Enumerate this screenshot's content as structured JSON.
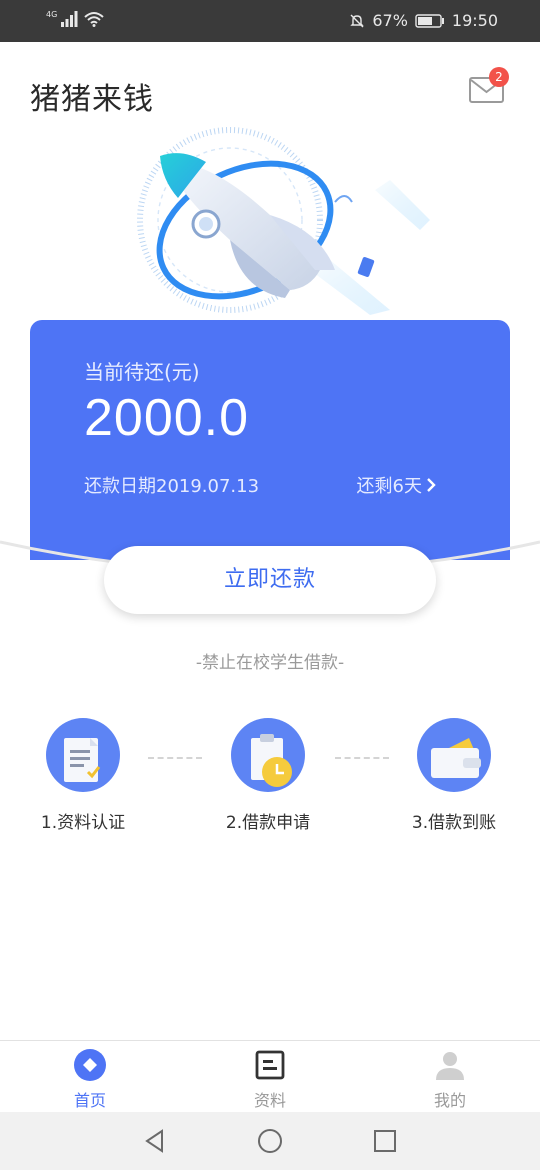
{
  "status_bar": {
    "network": "4G",
    "battery": "67%",
    "time": "19:50"
  },
  "header": {
    "title": "猪猪来钱",
    "mail_badge": "2",
    "mail_icon": "mail-icon"
  },
  "card": {
    "label": "当前待还(元)",
    "amount": "2000.0",
    "due_date": "还款日期2019.07.13",
    "remaining": "还剩6天",
    "color": "#4e74f5"
  },
  "repay_button": "立即还款",
  "notice": "-禁止在校学生借款-",
  "steps": [
    {
      "label": "1.资料认证",
      "icon": "document-check-icon"
    },
    {
      "label": "2.借款申请",
      "icon": "clipboard-clock-icon"
    },
    {
      "label": "3.借款到账",
      "icon": "wallet-icon"
    }
  ],
  "bottom_nav": [
    {
      "label": "首页",
      "icon": "home-diamond-icon",
      "active": true
    },
    {
      "label": "资料",
      "icon": "profile-card-icon",
      "active": false
    },
    {
      "label": "我的",
      "icon": "user-icon",
      "active": false
    }
  ],
  "colors": {
    "accent": "#4e74f5",
    "badge": "#f2524a",
    "nav_active": "#4e74f5",
    "nav_inactive": "#999999"
  }
}
